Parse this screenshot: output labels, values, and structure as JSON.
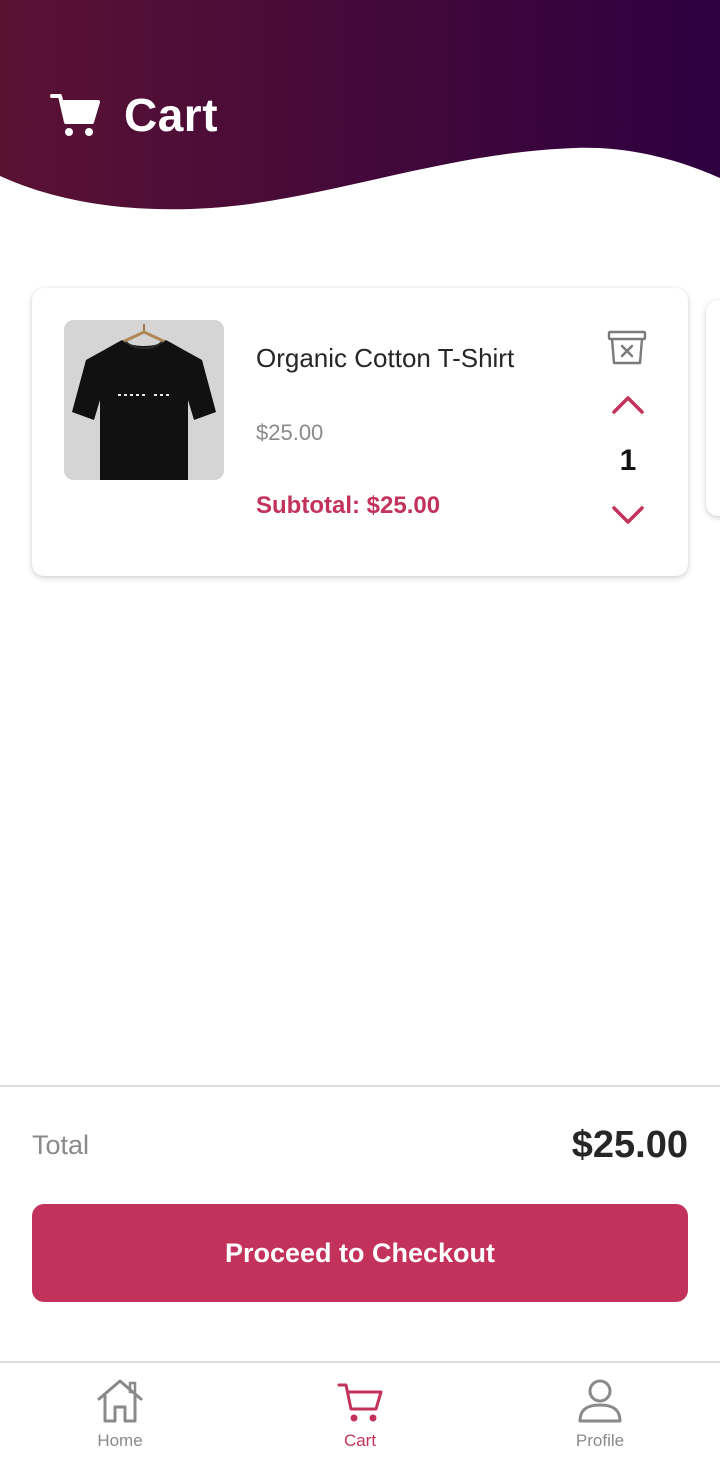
{
  "header": {
    "title": "Cart",
    "icon": "cart-icon"
  },
  "cart": {
    "items": [
      {
        "name": "Organic Cotton T-Shirt",
        "price": "$25.00",
        "subtotal": "Subtotal: $25.00",
        "quantity": "1",
        "image": "black-t-shirt-on-hanger"
      }
    ]
  },
  "summary": {
    "total_label": "Total",
    "total_value": "$25.00",
    "checkout_label": "Proceed to Checkout"
  },
  "nav": {
    "items": [
      {
        "label": "Home",
        "icon": "home-icon"
      },
      {
        "label": "Cart",
        "icon": "cart-icon",
        "active": true
      },
      {
        "label": "Profile",
        "icon": "user-icon"
      }
    ]
  },
  "colors": {
    "accent": "#c3325a",
    "header_gradient_start": "#5a1233",
    "header_gradient_end": "#2e0040",
    "muted_text": "#8a8a8a"
  }
}
